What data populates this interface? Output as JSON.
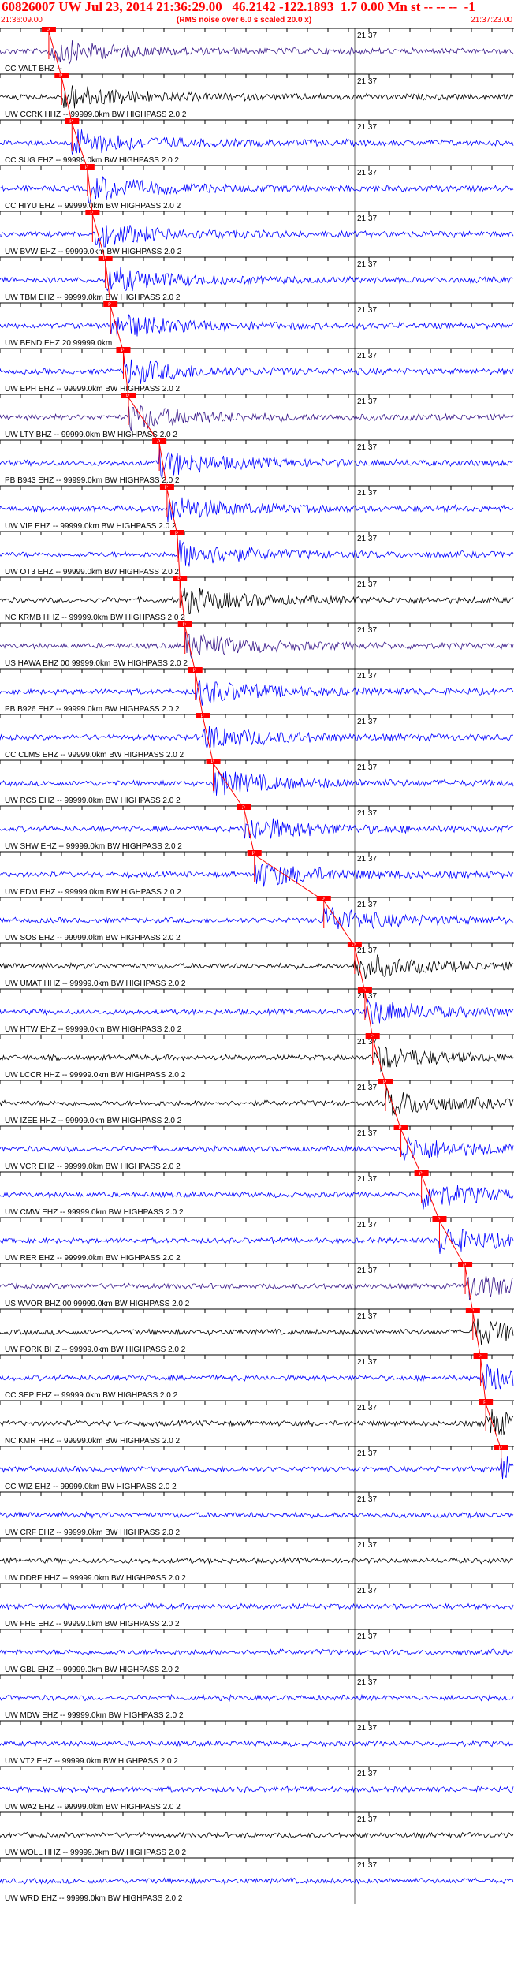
{
  "header": {
    "title": "60826007 UW Jul 23, 2014 21:36:29.00   46.2142 -122.1893  1.7 0.00 Mn st -- -- --  -1",
    "start_time": "21:36:09.00",
    "note": "(RMS noise over 6.0 s scaled 20.0 x)",
    "end_time": "21:37:23.00"
  },
  "minute_label": "21:37",
  "pick_label": "P",
  "colors": {
    "title": "#ff0000",
    "pick": "#ff0000",
    "trace_blue": "#0000ff",
    "trace_navy": "#00008b",
    "trace_black": "#000000",
    "trace_purple": "#3a1a8a"
  },
  "traces": [
    {
      "label": "CC VALT BHZ --",
      "color": "#3a1a8a",
      "pick": 0.095
    },
    {
      "label": "UW CCRK HHZ -- 99999.0km BW  HIGHPASS  2.0  2",
      "color": "#000000",
      "pick": 0.12
    },
    {
      "label": "CC SUG EHZ -- 99999.0km BW  HIGHPASS  2.0  2",
      "color": "#0000ff",
      "pick": 0.14
    },
    {
      "label": "CC HIYU EHZ -- 99999.0km BW  HIGHPASS  2.0  2",
      "color": "#0000ff",
      "pick": 0.17
    },
    {
      "label": "UW BVW EHZ -- 99999.0km BW  HIGHPASS  2.0  2",
      "color": "#0000ff",
      "pick": 0.18
    },
    {
      "label": "UW TBM EHZ -- 99999.0km BW  HIGHPASS  2.0  2",
      "color": "#0000ff",
      "pick": 0.205
    },
    {
      "label": "UW BEND EHZ 20 99999.0km",
      "color": "#0000ff",
      "pick": 0.215
    },
    {
      "label": "UW EPH EHZ -- 99999.0km BW  HIGHPASS  2.0  2",
      "color": "#0000ff",
      "pick": 0.24
    },
    {
      "label": "UW LTY BHZ -- 99999.0km BW  HIGHPASS  2.0  2",
      "color": "#3a1a8a",
      "pick": 0.25
    },
    {
      "label": "PB B943 EHZ -- 99999.0km BW  HIGHPASS  2.0  2",
      "color": "#0000ff",
      "pick": 0.31
    },
    {
      "label": "UW VIP EHZ -- 99999.0km BW  HIGHPASS  2.0  2",
      "color": "#0000ff",
      "pick": 0.325
    },
    {
      "label": "UW OT3 EHZ -- 99999.0km BW  HIGHPASS  2.0  2",
      "color": "#0000ff",
      "pick": 0.345
    },
    {
      "label": "NC KRMB HHZ -- 99999.0km BW  HIGHPASS  2.0  2",
      "color": "#000000",
      "pick": 0.35
    },
    {
      "label": "US HAWA BHZ 00 99999.0km BW  HIGHPASS  2.0  2",
      "color": "#3a1a8a",
      "pick": 0.36
    },
    {
      "label": "PB B926 EHZ -- 99999.0km BW  HIGHPASS  2.0  2",
      "color": "#0000ff",
      "pick": 0.38
    },
    {
      "label": "CC CLMS EHZ -- 99999.0km BW  HIGHPASS  2.0  2",
      "color": "#0000ff",
      "pick": 0.395
    },
    {
      "label": "UW RCS EHZ -- 99999.0km BW  HIGHPASS  2.0  2",
      "color": "#0000ff",
      "pick": 0.415
    },
    {
      "label": "UW SHW EHZ -- 99999.0km BW  HIGHPASS  2.0  2",
      "color": "#0000ff",
      "pick": 0.475
    },
    {
      "label": "UW EDM EHZ -- 99999.0km BW  HIGHPASS  2.0  2",
      "color": "#0000ff",
      "pick": 0.495
    },
    {
      "label": "UW SOS EHZ -- 99999.0km BW  HIGHPASS  2.0  2",
      "color": "#0000ff",
      "pick": 0.63
    },
    {
      "label": "UW UMAT HHZ -- 99999.0km BW  HIGHPASS  2.0  2",
      "color": "#000000",
      "pick": 0.69
    },
    {
      "label": "UW HTW EHZ -- 99999.0km BW  HIGHPASS  2.0  2",
      "color": "#0000ff",
      "pick": 0.71
    },
    {
      "label": "UW LCCR HHZ -- 99999.0km BW  HIGHPASS  2.0  2",
      "color": "#000000",
      "pick": 0.725
    },
    {
      "label": "UW IZEE HHZ -- 99999.0km BW  HIGHPASS  2.0  2",
      "color": "#000000",
      "pick": 0.75
    },
    {
      "label": "UW VCR EHZ -- 99999.0km BW  HIGHPASS  2.0  2",
      "color": "#0000ff",
      "pick": 0.78
    },
    {
      "label": "UW CMW EHZ -- 99999.0km BW  HIGHPASS  2.0  2",
      "color": "#0000ff",
      "pick": 0.82
    },
    {
      "label": "UW RER EHZ -- 99999.0km BW  HIGHPASS  2.0  2",
      "color": "#0000ff",
      "pick": 0.855
    },
    {
      "label": "US WVOR BHZ 00 99999.0km BW  HIGHPASS  2.0  2",
      "color": "#3a1a8a",
      "pick": 0.905
    },
    {
      "label": "UW FORK BHZ -- 99999.0km BW  HIGHPASS  2.0  2",
      "color": "#000000",
      "pick": 0.92
    },
    {
      "label": "CC SEP EHZ -- 99999.0km BW  HIGHPASS  2.0  2",
      "color": "#0000ff",
      "pick": 0.935
    },
    {
      "label": "NC KMR HHZ -- 99999.0km BW  HIGHPASS  2.0  2",
      "color": "#000000",
      "pick": 0.945
    },
    {
      "label": "CC WIZ EHZ -- 99999.0km BW  HIGHPASS  2.0  2",
      "color": "#0000ff",
      "pick": 0.975
    },
    {
      "label": "UW CRF EHZ -- 99999.0km BW  HIGHPASS  2.0  2",
      "color": "#0000ff",
      "pick": null
    },
    {
      "label": "UW DDRF HHZ -- 99999.0km BW  HIGHPASS  2.0  2",
      "color": "#000000",
      "pick": null
    },
    {
      "label": "UW FHE EHZ -- 99999.0km BW  HIGHPASS  2.0  2",
      "color": "#0000ff",
      "pick": null
    },
    {
      "label": "UW GBL EHZ -- 99999.0km BW  HIGHPASS  2.0  2",
      "color": "#0000ff",
      "pick": null
    },
    {
      "label": "UW MDW EHZ -- 99999.0km BW  HIGHPASS  2.0  2",
      "color": "#0000ff",
      "pick": null
    },
    {
      "label": "UW VT2 EHZ -- 99999.0km BW  HIGHPASS  2.0  2",
      "color": "#0000ff",
      "pick": null
    },
    {
      "label": "UW WA2 EHZ -- 99999.0km BW  HIGHPASS  2.0  2",
      "color": "#0000ff",
      "pick": null
    },
    {
      "label": "UW WOLL HHZ -- 99999.0km BW  HIGHPASS  2.0  2",
      "color": "#000000",
      "pick": null
    },
    {
      "label": "UW WRD EHZ -- 99999.0km BW  HIGHPASS  2.0  2",
      "color": "#0000ff",
      "pick": null
    }
  ]
}
